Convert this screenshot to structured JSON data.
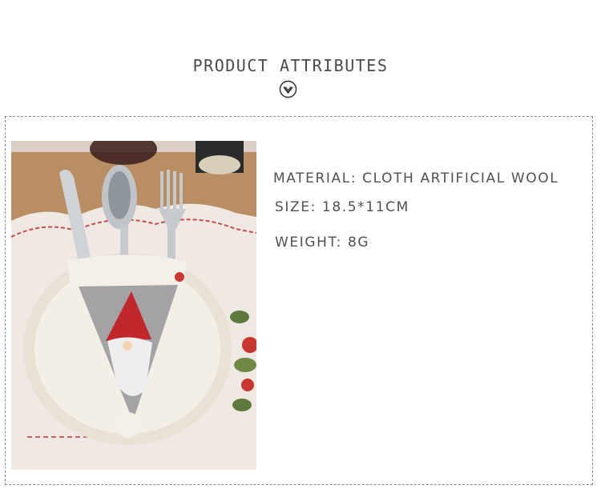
{
  "header": {
    "title": "PRODUCT ATTRIBUTES"
  },
  "icons": {
    "down_chevron": "chevron-down-circle-icon"
  },
  "product": {
    "attributes": [
      "MATERIAL: CLOTH ARTIFICIAL WOOL",
      "SIZE: 18.5*11CM",
      "WEIGHT: 8G"
    ]
  },
  "colors": {
    "text": "#4a4a4a",
    "frame_border": "#8a8a8a",
    "gnome_hat": "#c0282d",
    "felt_gray": "#9a9a9a"
  }
}
